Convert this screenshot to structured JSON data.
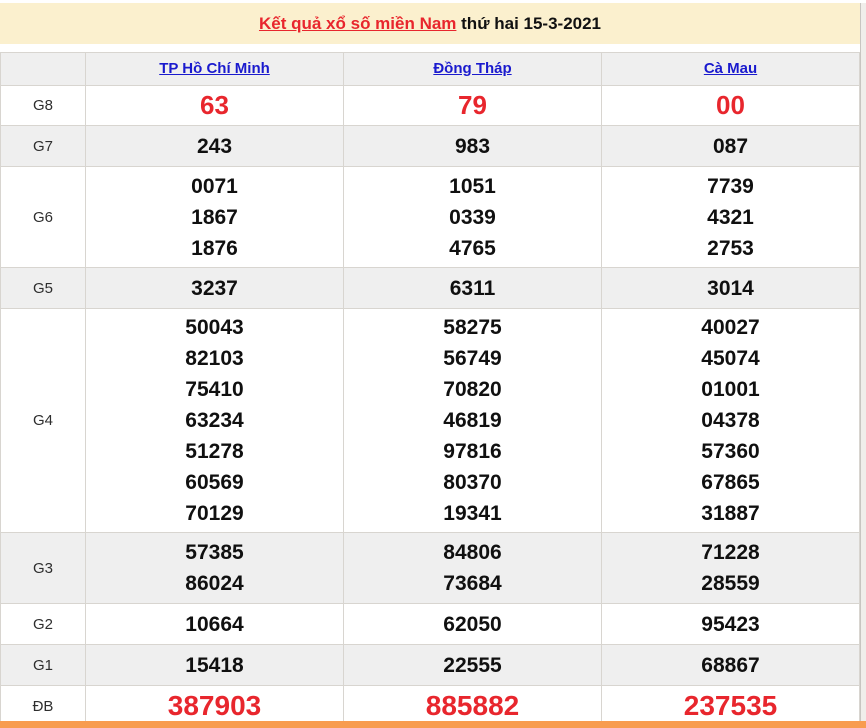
{
  "title": {
    "link": "Kết quả xổ số miền Nam",
    "rest": " thứ hai 15-3-2021"
  },
  "columns": [
    "TP Hồ Chí Minh",
    "Đồng Tháp",
    "Cà Mau"
  ],
  "rows": [
    {
      "label": "G8",
      "highlight": true,
      "values": [
        [
          "63"
        ],
        [
          "79"
        ],
        [
          "00"
        ]
      ]
    },
    {
      "label": "G7",
      "values": [
        [
          "243"
        ],
        [
          "983"
        ],
        [
          "087"
        ]
      ]
    },
    {
      "label": "G6",
      "values": [
        [
          "0071",
          "1867",
          "1876"
        ],
        [
          "1051",
          "0339",
          "4765"
        ],
        [
          "7739",
          "4321",
          "2753"
        ]
      ]
    },
    {
      "label": "G5",
      "values": [
        [
          "3237"
        ],
        [
          "6311"
        ],
        [
          "3014"
        ]
      ]
    },
    {
      "label": "G4",
      "values": [
        [
          "50043",
          "82103",
          "75410",
          "63234",
          "51278",
          "60569",
          "70129"
        ],
        [
          "58275",
          "56749",
          "70820",
          "46819",
          "97816",
          "80370",
          "19341"
        ],
        [
          "40027",
          "45074",
          "01001",
          "04378",
          "57360",
          "67865",
          "31887"
        ]
      ]
    },
    {
      "label": "G3",
      "values": [
        [
          "57385",
          "86024"
        ],
        [
          "84806",
          "73684"
        ],
        [
          "71228",
          "28559"
        ]
      ]
    },
    {
      "label": "G2",
      "values": [
        [
          "10664"
        ],
        [
          "62050"
        ],
        [
          "95423"
        ]
      ]
    },
    {
      "label": "G1",
      "values": [
        [
          "15418"
        ],
        [
          "22555"
        ],
        [
          "68867"
        ]
      ]
    },
    {
      "label": "ĐB",
      "highlight": true,
      "values": [
        [
          "387903"
        ],
        [
          "885882"
        ],
        [
          "237535"
        ]
      ]
    }
  ],
  "colors": {
    "highlight_red": "#e8262d",
    "link_blue": "#1a1ace",
    "title_bg": "#fbf0ce",
    "row_gray": "#efefef",
    "border": "#d8d5d0",
    "bottom_bar_orange": "#f89c50"
  }
}
